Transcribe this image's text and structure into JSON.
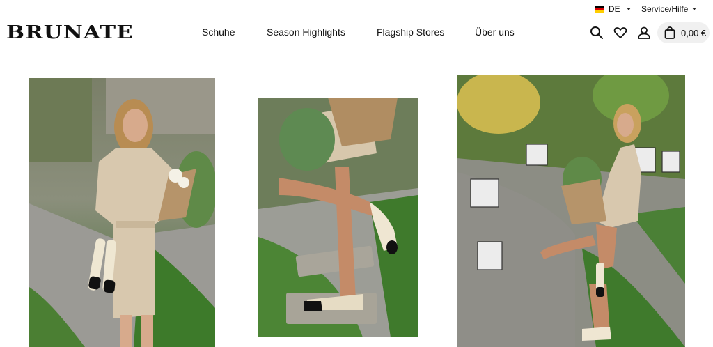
{
  "header": {
    "language": {
      "code": "DE"
    },
    "service_label": "Service/Hilfe",
    "logo_text": "BRUNATE",
    "nav": [
      {
        "label": "Schuhe"
      },
      {
        "label": "Season Highlights"
      },
      {
        "label": "Flagship Stores"
      },
      {
        "label": "Über uns"
      }
    ],
    "cart_total": "0,00 €"
  },
  "icons": [
    "search-icon",
    "heart-icon",
    "user-icon",
    "shopping-bag-icon",
    "flag-de-icon"
  ],
  "images": [
    {
      "name": "lookbook-image-woman-holding-flats"
    },
    {
      "name": "lookbook-image-legs-ballerina-flats"
    },
    {
      "name": "lookbook-image-woman-posing-garden"
    }
  ],
  "colors": {
    "text": "#111111",
    "cart_bg": "#f0f0f0",
    "grass": "#4f8a3a",
    "dress": "#d8c8ae"
  }
}
